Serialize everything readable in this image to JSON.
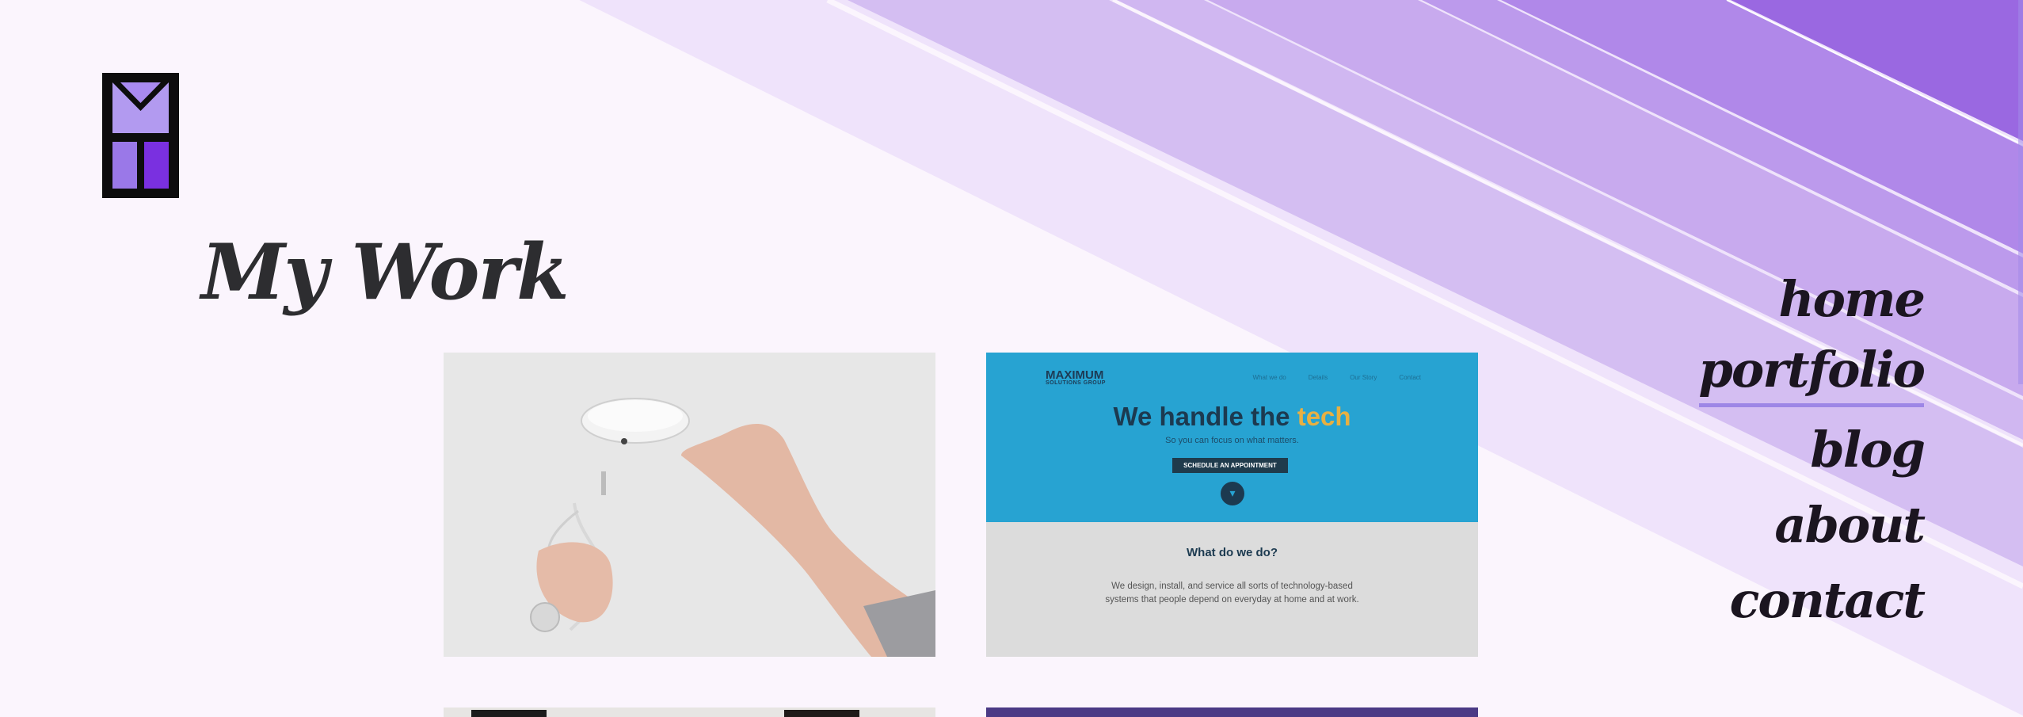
{
  "page": {
    "title": "My Work"
  },
  "nav": {
    "items": [
      {
        "label": "home",
        "active": false
      },
      {
        "label": "portfolio",
        "active": true
      },
      {
        "label": "blog",
        "active": false
      },
      {
        "label": "about",
        "active": false
      },
      {
        "label": "contact",
        "active": false
      }
    ]
  },
  "colors": {
    "background": "#fbf5fd",
    "accent": "#9d86e6",
    "text": "#2d2d30"
  },
  "portfolio": {
    "items": [
      {
        "name": "product-photo-earbud-case"
      },
      {
        "name": "maximum-solutions-website",
        "site_logo": "MAXIMUM",
        "site_logo_sub": "SOLUTIONS GROUP",
        "site_nav": [
          "What we do",
          "Details",
          "Our Story",
          "Contact"
        ],
        "headline_lead": "We handle the ",
        "headline_accent": "tech",
        "subheadline": "So you can focus on what matters.",
        "cta": "SCHEDULE AN APPOINTMENT",
        "section_title": "What do we do?",
        "section_body": "We design, install, and service all sorts of technology-based systems that people depend on everyday at home and at work."
      },
      {
        "name": "portfolio-item-3"
      },
      {
        "name": "portfolio-item-4"
      }
    ]
  }
}
